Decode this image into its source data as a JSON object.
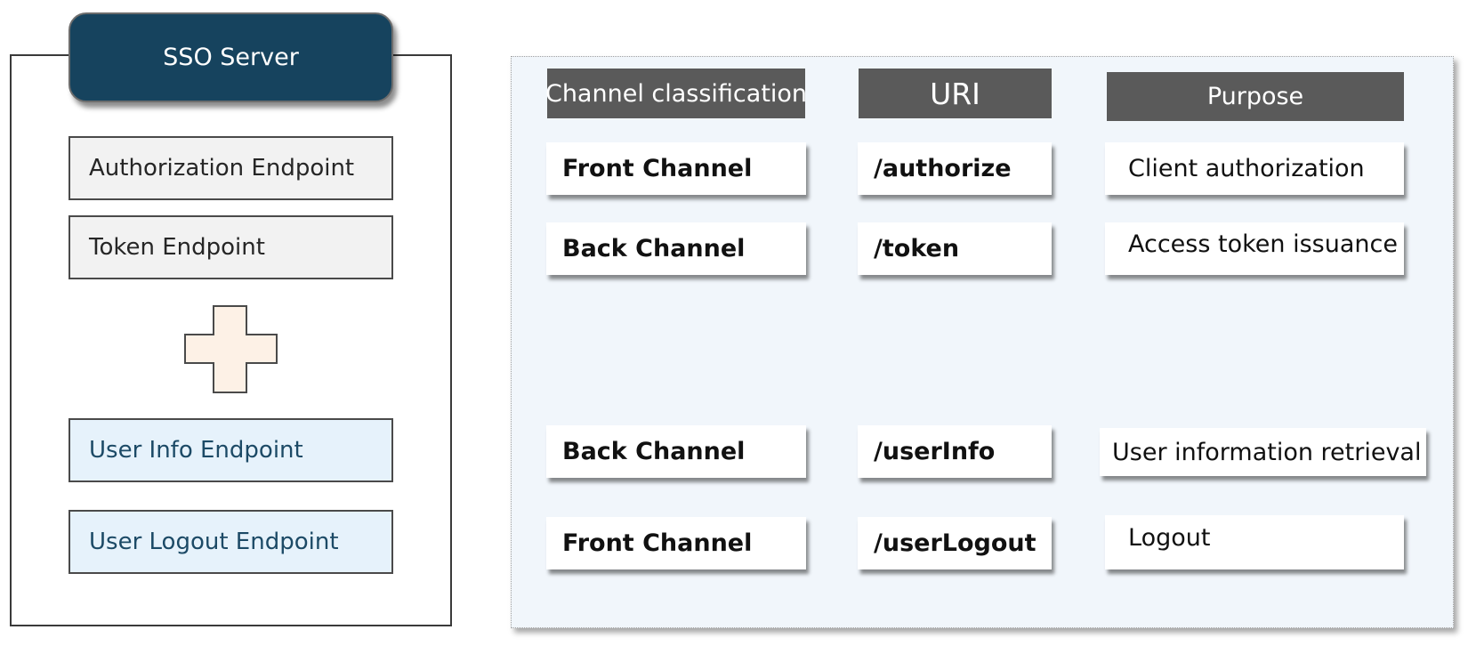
{
  "server": {
    "title": "SSO Server",
    "core_endpoints": [
      "Authorization Endpoint",
      "Token Endpoint"
    ],
    "extended_endpoints": [
      "User Info Endpoint",
      "User Logout Endpoint"
    ],
    "plus_icon": "plus-icon"
  },
  "table": {
    "headers": [
      "Channel classification",
      "URI",
      "Purpose"
    ],
    "rows": [
      {
        "channel": "Front Channel",
        "uri": "/authorize",
        "purpose": "Client authorization"
      },
      {
        "channel": "Back Channel",
        "uri": "/token",
        "purpose": "Access token issuance"
      },
      {
        "channel": "Back Channel",
        "uri": "/userInfo",
        "purpose": "User information retrieval"
      },
      {
        "channel": "Front Channel",
        "uri": "/userLogout",
        "purpose": "Logout"
      }
    ]
  },
  "colors": {
    "server_title_bg": "#16435e",
    "core_endpoint_bg": "#f2f2f2",
    "extended_endpoint_bg": "#e6f2fb",
    "header_bg": "#5a5a5a",
    "panel_bg": "#f1f6fb",
    "plus_fill": "#fdf1e6"
  }
}
